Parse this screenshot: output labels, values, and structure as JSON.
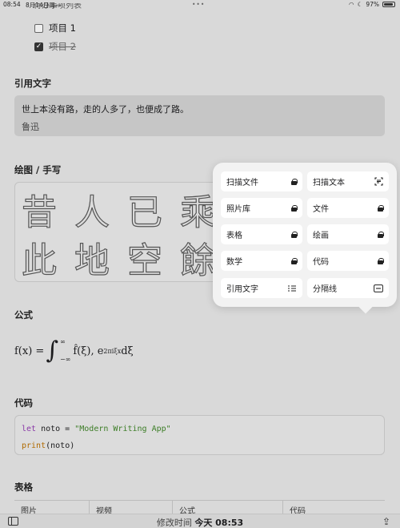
{
  "status": {
    "time": "08:54",
    "date": "8月14日周一",
    "battery": "97%"
  },
  "todo": {
    "cut_heading": "待办事项列表",
    "items": [
      {
        "label": "项目 1",
        "checked": false
      },
      {
        "label": "项目 2",
        "checked": true
      }
    ]
  },
  "quote": {
    "heading": "引用文字",
    "text": "世上本没有路，走的人多了，也便成了路。",
    "author": "鲁迅"
  },
  "drawing": {
    "heading": "绘图 / 手写",
    "line1": "昔人已乘",
    "line2": "此地空餘"
  },
  "formula": {
    "heading": "公式",
    "lhs": "f(x) =",
    "upper": "∞",
    "lower": "−∞",
    "integrand": "f̂(ξ), e",
    "exponent": "2πiξx",
    "diff": " dξ"
  },
  "code": {
    "heading": "代码",
    "l1_kw": "let",
    "l1_rest": " noto = ",
    "l1_str": "\"Modern Writing App\"",
    "l2_fn": "print",
    "l2_rest": "(noto)"
  },
  "table": {
    "heading": "表格",
    "headers": [
      "图片",
      "视频",
      "公式",
      "代码"
    ]
  },
  "bottom": {
    "modified_label": "修改时间",
    "modified_value": "今天 08:53"
  },
  "popover": {
    "items": [
      {
        "label": "扫描文件",
        "icon": "lock-icon"
      },
      {
        "label": "扫描文本",
        "icon": "scan-text-icon"
      },
      {
        "label": "照片库",
        "icon": "lock-icon"
      },
      {
        "label": "文件",
        "icon": "lock-icon"
      },
      {
        "label": "表格",
        "icon": "lock-icon"
      },
      {
        "label": "绘画",
        "icon": "lock-icon"
      },
      {
        "label": "数学",
        "icon": "lock-icon"
      },
      {
        "label": "代码",
        "icon": "lock-icon"
      },
      {
        "label": "引用文字",
        "icon": "quote-icon"
      },
      {
        "label": "分隔线",
        "icon": "divider-icon"
      }
    ]
  }
}
